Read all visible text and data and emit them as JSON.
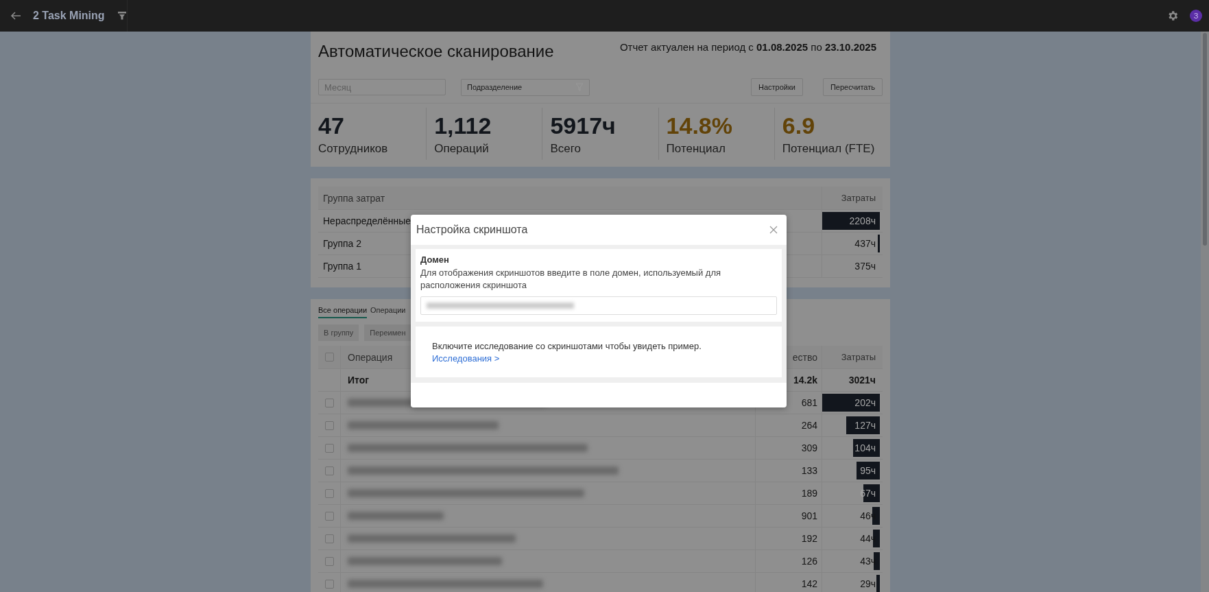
{
  "top_bar": {
    "title": "2 Task Mining",
    "avatar": "З"
  },
  "header": {
    "title": "Автоматическое сканирование",
    "period": "Отчет актуален на период с **01.08.2025** по **23.10.2025**",
    "month_field": {
      "placeholder": "Месяц"
    },
    "division_filter": {
      "label": "Подразделение"
    },
    "buttons": [
      "Настройки",
      "Пересчитать"
    ]
  },
  "metrics": [
    {
      "value": "47",
      "label": "Сотрудников",
      "color": "#12161c"
    },
    {
      "value": "1,112",
      "label": "Операций",
      "color": "#12161c"
    },
    {
      "value": "5917ч",
      "label": "Всего",
      "color": "#12161c"
    },
    {
      "value": "14.8%",
      "label": "Потенциал",
      "color": "#624308"
    },
    {
      "value": "6.9",
      "label": "Потенциал (FTE)",
      "color": "#624308"
    }
  ],
  "cost_groups": {
    "columns": [
      "Группа затрат",
      "Затраты"
    ],
    "rows": [
      {
        "name": "Нераспределённые",
        "cost": "2208ч",
        "level": 1
      },
      {
        "name": "Группа 2",
        "cost": "437ч",
        "level": 0.04
      },
      {
        "name": "Группа 1",
        "cost": "375ч",
        "level": 0
      }
    ]
  },
  "operations": {
    "tabs": [
      {
        "label": "Все операции",
        "selected": true
      },
      {
        "label": "Операции",
        "selected": false
      }
    ],
    "buttons": [
      "В группу",
      "Переимен"
    ],
    "header_checked": false,
    "columns": [
      "Операция",
      "ество",
      "Затраты"
    ],
    "total": {
      "label": "Итог",
      "count": "14.2k",
      "cost": "3021ч"
    },
    "rows": [
      {
        "checked": false,
        "count": "681",
        "cost": "202ч",
        "level": 1
      },
      {
        "checked": false,
        "count": "264",
        "cost": "127ч",
        "level": 0.58
      },
      {
        "checked": false,
        "count": "309",
        "cost": "104ч",
        "level": 0.46
      },
      {
        "checked": false,
        "count": "133",
        "cost": "95ч",
        "level": 0.41
      },
      {
        "checked": false,
        "count": "189",
        "cost": "67ч",
        "level": 0.28
      },
      {
        "checked": false,
        "count": "901",
        "cost": "46ч",
        "level": 0.13
      },
      {
        "checked": false,
        "count": "192",
        "cost": "44ч",
        "level": 0.12
      },
      {
        "checked": false,
        "count": "126",
        "cost": "43ч",
        "level": 0.11
      },
      {
        "checked": false,
        "count": "142",
        "cost": "29ч",
        "level": 0.06
      }
    ]
  },
  "modal": {
    "title": "Настройка скриншота",
    "section_title": "Домен",
    "description": "Для отображения скриншотов введите в поле домен, используемый для расположения скриншота",
    "hint": "Включите исследование со скриншотами чтобы увидеть пример.",
    "link": "Исследования >"
  }
}
